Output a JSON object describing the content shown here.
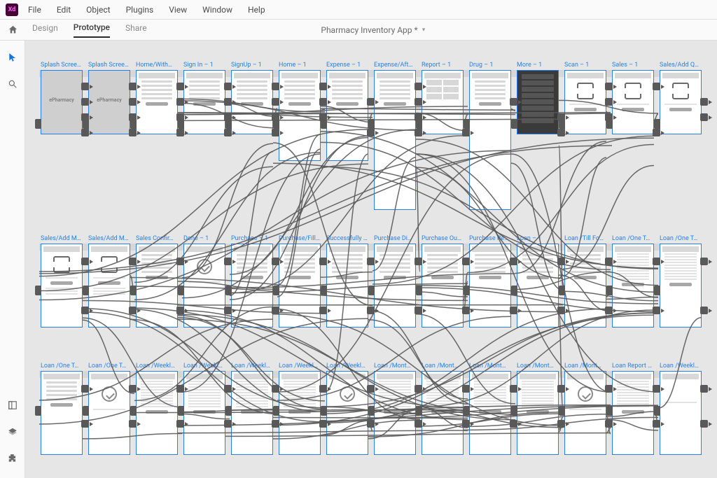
{
  "menubar": {
    "items": [
      "File",
      "Edit",
      "Object",
      "Plugins",
      "View",
      "Window",
      "Help"
    ]
  },
  "tabs": {
    "design": "Design",
    "prototype": "Prototype",
    "share": "Share"
  },
  "document": {
    "title": "Pharmacy Inventory App *"
  },
  "row1": [
    {
      "label": "Splash Scree…",
      "kind": "splash",
      "logo": "ePharmacy"
    },
    {
      "label": "Splash Scree…",
      "kind": "splash",
      "logo": "ePharmacy"
    },
    {
      "label": "Home/With…",
      "kind": "form",
      "tall": false
    },
    {
      "label": "Sign In – 1",
      "kind": "form"
    },
    {
      "label": "SignUp – 1",
      "kind": "form"
    },
    {
      "label": "Home – 1",
      "kind": "list",
      "tall": "med"
    },
    {
      "label": "Expense – 1",
      "kind": "list",
      "tall": "med"
    },
    {
      "label": "Expense/Aft…",
      "kind": "list",
      "tall": "tall"
    },
    {
      "label": "Report – 1",
      "kind": "grid"
    },
    {
      "label": "Drug – 1",
      "kind": "list",
      "tall": "tall"
    },
    {
      "label": "More – 1",
      "kind": "more"
    },
    {
      "label": "Scan – 1",
      "kind": "scan"
    },
    {
      "label": "Sales – 1",
      "kind": "scan"
    },
    {
      "label": "Sales/Add Q…",
      "kind": "scan"
    }
  ],
  "row2": [
    {
      "label": "Sales/Add M…",
      "kind": "scan2"
    },
    {
      "label": "Sales/Add M…",
      "kind": "scan2"
    },
    {
      "label": "Sales Confir…",
      "kind": "list"
    },
    {
      "label": "Done – 1",
      "kind": "done"
    },
    {
      "label": "Purchase – 1",
      "kind": "list"
    },
    {
      "label": "Purchase/Fill…",
      "kind": "list"
    },
    {
      "label": "Successfully …",
      "kind": "list"
    },
    {
      "label": "Purchase Di…",
      "kind": "list"
    },
    {
      "label": "Purchase Ou…",
      "kind": "list"
    },
    {
      "label": "Purchase Re…",
      "kind": "list"
    },
    {
      "label": "Loan – 1",
      "kind": "form"
    },
    {
      "label": "Loan /Till Fo…",
      "kind": "form"
    },
    {
      "label": "Loan /One T…",
      "kind": "text"
    },
    {
      "label": "Loan /One T…",
      "kind": "text"
    }
  ],
  "row3": [
    {
      "label": "Loan /One T…",
      "kind": "form"
    },
    {
      "label": "Loan /One T…",
      "kind": "done"
    },
    {
      "label": "Loan /Weekl…",
      "kind": "text"
    },
    {
      "label": "Loan /Weekl…",
      "kind": "text"
    },
    {
      "label": "Loan /Weekl…",
      "kind": "text"
    },
    {
      "label": "Loan /Weekl…",
      "kind": "text"
    },
    {
      "label": "Loan /Weekl…",
      "kind": "done"
    },
    {
      "label": "Loan /Mont…",
      "kind": "text"
    },
    {
      "label": "Loan /Mont…",
      "kind": "text"
    },
    {
      "label": "Loan /Mont…",
      "kind": "text"
    },
    {
      "label": "Loan /Mont…",
      "kind": "text"
    },
    {
      "label": "Loan /Mont…",
      "kind": "done"
    },
    {
      "label": "Loan Report …",
      "kind": "text"
    },
    {
      "label": "Loan /Weekl…",
      "kind": "blank"
    }
  ]
}
